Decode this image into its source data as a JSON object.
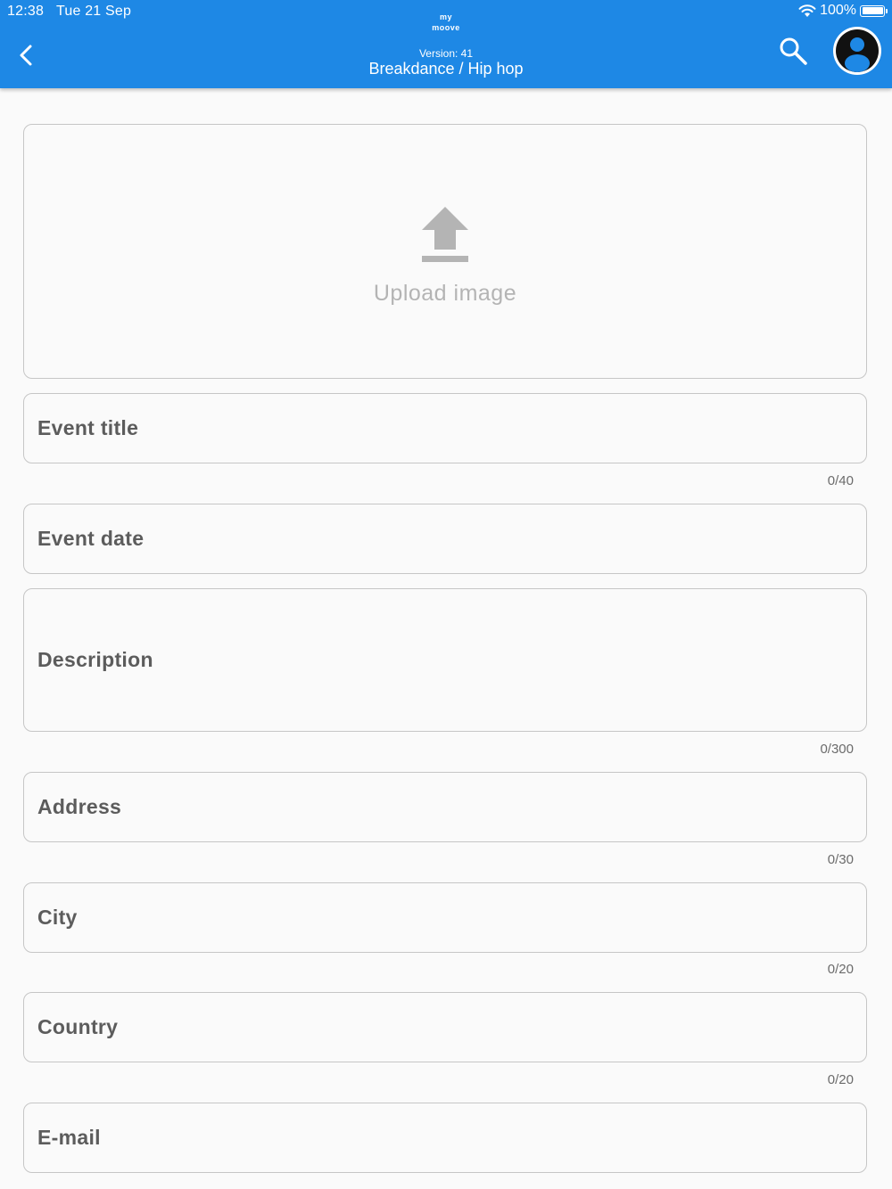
{
  "status_bar": {
    "time": "12:38",
    "date": "Tue 21 Sep",
    "battery": "100%"
  },
  "header": {
    "logo_line1": "my",
    "logo_line2": "moove",
    "version": "Version: 41",
    "title": "Breakdance / Hip hop",
    "color": "#1e88e5"
  },
  "upload": {
    "label": "Upload image",
    "icon": "upload-icon"
  },
  "fields": {
    "event_title": {
      "label": "Event title",
      "counter": "0/40"
    },
    "event_date": {
      "label": "Event date"
    },
    "description": {
      "label": "Description",
      "counter": "0/300"
    },
    "address": {
      "label": "Address",
      "counter": "0/30"
    },
    "city": {
      "label": "City",
      "counter": "0/20"
    },
    "country": {
      "label": "Country",
      "counter": "0/20"
    },
    "email": {
      "label": "E-mail"
    }
  },
  "icons": [
    "back-arrow-icon",
    "search-icon",
    "account-avatar-icon",
    "wifi-icon",
    "battery-icon",
    "upload-icon"
  ]
}
